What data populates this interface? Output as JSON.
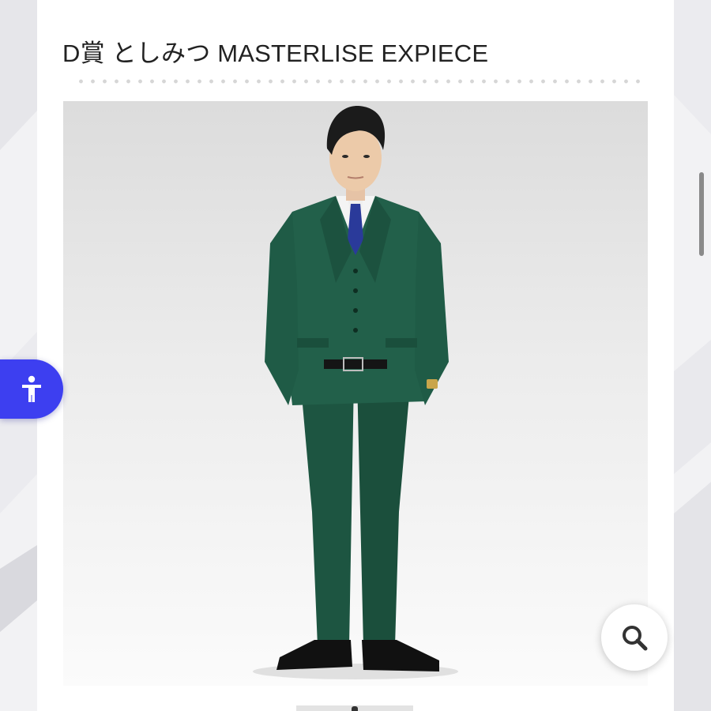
{
  "product": {
    "title": "D賞 としみつ MASTERLISE EXPIECE"
  },
  "icons": {
    "zoom": "search-icon",
    "accessibility": "accessibility-icon"
  },
  "colors": {
    "accessibility_button": "#3d3ff0",
    "suit": "#1f5a45",
    "tie": "#2a3a9a"
  }
}
